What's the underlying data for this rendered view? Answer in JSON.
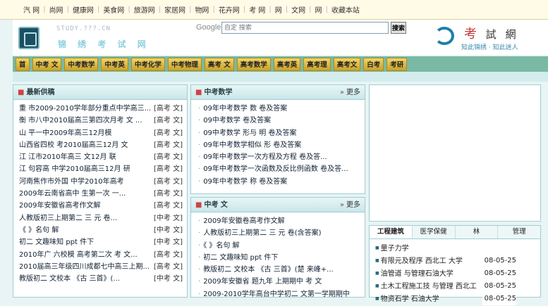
{
  "top_links": [
    "汽 网",
    "尚网",
    "健康网",
    "美食网",
    "旅游网",
    "家居网",
    "物网",
    "花卉网",
    "考 网",
    "网",
    "文网",
    "网",
    "收藏本站"
  ],
  "header": {
    "site_url": "STUDY.???.CN",
    "site_name": "锦 绣 考 试 网",
    "search": {
      "brand": "Google",
      "placeholder": "自定 搜索",
      "button_label": "搜索"
    },
    "brand": {
      "char1": "考",
      "char2": "試",
      "char3": "網",
      "slogan": "知此锦绣 · 知此迷人"
    }
  },
  "nav": [
    "首",
    "中考 文",
    "中考数学",
    "中考英",
    "中考化学",
    "中考物理",
    "高考 文",
    "高考数学",
    "高考英",
    "高考理",
    "高考文",
    "白考",
    "考研"
  ],
  "latest": {
    "title": "最新供稿",
    "items": [
      {
        "title": "重 市2009-2010学年部分重点中学高三...",
        "cat": "[高考 文]"
      },
      {
        "title": "衡 市八中2010届高三第四次月考 文 ...",
        "cat": "[高考 文]"
      },
      {
        "title": "山 平一中2009年高三12月模",
        "cat": "[高考 文]"
      },
      {
        "title": "山西省四校 考2010届高三12月 文",
        "cat": "[高考 文]"
      },
      {
        "title": "江 江市2010年高三 文12月 联",
        "cat": "[高考 文]"
      },
      {
        "title": "江 句容高 中学2010届高三12月 研",
        "cat": "[高考 文]"
      },
      {
        "title": "河南焦作市外国 中学2010年高考",
        "cat": "[高考 文]"
      },
      {
        "title": "2009年云南省高中 生第一次 一...",
        "cat": "[高考 文]"
      },
      {
        "title": "2009年安徽省高考作文解",
        "cat": "[高考 文]"
      },
      {
        "title": "人教版初三上期第二 三 元 卷...",
        "cat": "[中考 文]"
      },
      {
        "title": "《 》名句 解",
        "cat": "[中考 文]"
      },
      {
        "title": "初二 文趣味知 ppt 件下",
        "cat": "[中考 文]"
      },
      {
        "title": "2010年广 六校模 高考第二次 考 文...",
        "cat": "[高考 文]"
      },
      {
        "title": "2010届高三年级四川成都七中高三上期...",
        "cat": "[高考 文]"
      },
      {
        "title": "教版初二 文校本 《古 三首》(...",
        "cat": "[中考 文]"
      }
    ]
  },
  "math": {
    "title": "中考数学",
    "more_label": "更多",
    "items": [
      "09年中考数学 数 卷及答案",
      "09中考数学 卷及答案",
      "09中考数学 形与 明 卷及答案",
      "09年中考数学相似 形 卷及答案",
      "09年中考数学一次方程及方程 卷及答...",
      "09年中考数学一次函数及反比例函数 卷及答...",
      "09年中考数学 称 卷及答案"
    ]
  },
  "chinese": {
    "title": "中考 文",
    "more_label": "更多",
    "items": [
      "2009年安徽卷高考作文解",
      "人教版初三上期第二 三 元 卷(含答案)",
      "《 》名句 解",
      "初二 文趣味知 ppt 件下",
      "教版初二 文校本 《古 三首》(楚 来峰+...",
      "2009年安徽省 题九年 上期期中 考 文",
      "2009-2010学年高台中学初二 文第一学期期中"
    ]
  },
  "tabs": {
    "labels": [
      "工程建筑",
      "医学保健",
      "林",
      "管理"
    ],
    "active": 0,
    "items": [
      {
        "title": "量子力学",
        "date": ""
      },
      {
        "title": "有限元及程序 西北工 大学",
        "date": "08-05-25"
      },
      {
        "title": "油管道 与管理石油大学",
        "date": "08-05-25"
      },
      {
        "title": "土木工程施工技 与管理 西北工",
        "date": "08-05-25"
      },
      {
        "title": "物资石学 石油大学",
        "date": "08-05-25"
      }
    ]
  }
}
